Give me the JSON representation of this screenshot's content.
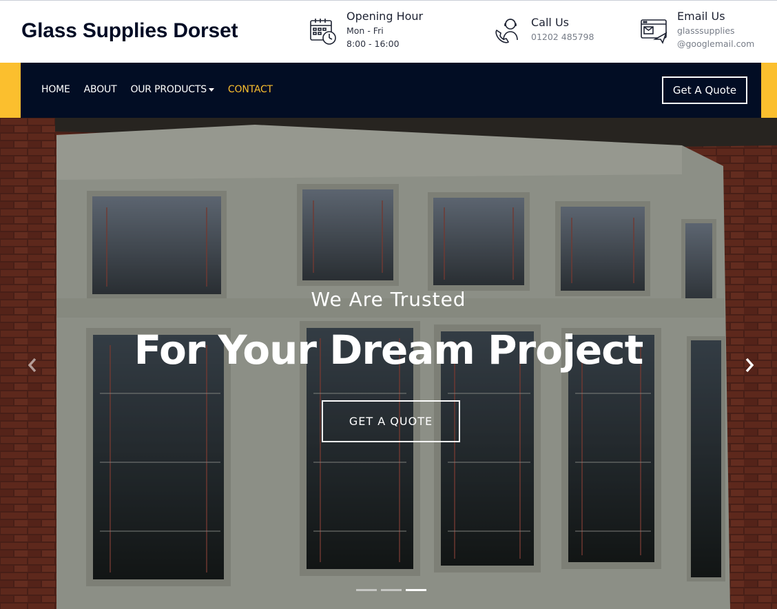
{
  "header": {
    "brand": "Glass Supplies Dorset",
    "opening": {
      "title": "Opening Hour",
      "line1": "Mon - Fri",
      "line2": "8:00 - 16:00",
      "icon": "calendar-clock-icon"
    },
    "call": {
      "title": "Call Us",
      "phone": "01202 485798",
      "icon": "support-agent-icon"
    },
    "email": {
      "title": "Email Us",
      "line1": "glasssupplies",
      "line2": "@googlemail.com",
      "icon": "email-icon"
    }
  },
  "nav": {
    "items": [
      {
        "label": "HOME"
      },
      {
        "label": "ABOUT"
      },
      {
        "label": "OUR PRODUCTS"
      },
      {
        "label": "CONTACT",
        "active": true
      }
    ],
    "quote_button": "Get A Quote"
  },
  "hero": {
    "kicker": "We Are Trusted",
    "headline": "For Your Dream Project",
    "cta": "GET A QUOTE",
    "slides_total": 3,
    "active_slide": 3,
    "prev_icon": "chevron-left-icon",
    "next_icon": "chevron-right-icon"
  },
  "colors": {
    "navy": "#020d24",
    "accent": "#fbbf2e",
    "text": "#000b24"
  }
}
